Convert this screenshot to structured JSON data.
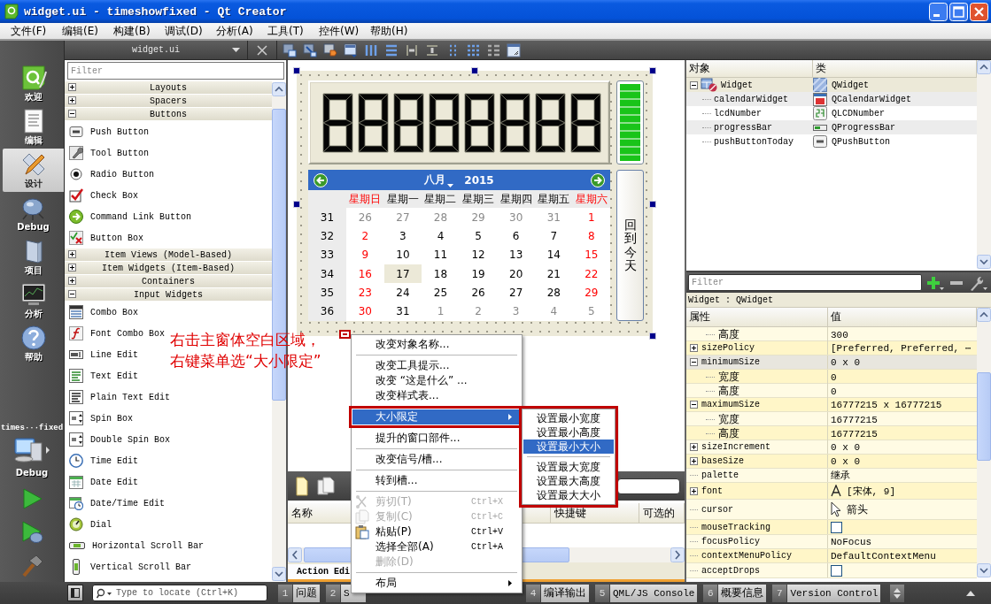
{
  "window": {
    "title": "widget.ui - timeshowfixed - Qt Creator"
  },
  "menu_bar": [
    "文件(F)",
    "编辑(E)",
    "构建(B)",
    "调试(D)",
    "分析(A)",
    "工具(T)",
    "控件(W)",
    "帮助(H)"
  ],
  "mode_bar": {
    "modes": [
      {
        "label": "欢迎",
        "selected": false
      },
      {
        "label": "编辑",
        "selected": false
      },
      {
        "label": "设计",
        "selected": true
      },
      {
        "label": "Debug",
        "selected": false
      },
      {
        "label": "项目",
        "selected": false
      },
      {
        "label": "分析",
        "selected": false
      },
      {
        "label": "帮助",
        "selected": false
      }
    ],
    "project": "times···fixed",
    "build_config": "Debug"
  },
  "editor_toolbar": {
    "file": "widget.ui"
  },
  "widget_box": {
    "filter_placeholder": "Filter",
    "categories": [
      {
        "label": "Layouts",
        "expanded": false
      },
      {
        "label": "Spacers",
        "expanded": false
      },
      {
        "label": "Buttons",
        "expanded": true,
        "items": [
          "Push Button",
          "Tool Button",
          "Radio Button",
          "Check Box",
          "Command Link Button",
          "Button Box"
        ]
      },
      {
        "label": "Item Views (Model-Based)",
        "expanded": false
      },
      {
        "label": "Item Widgets (Item-Based)",
        "expanded": false
      },
      {
        "label": "Containers",
        "expanded": false
      },
      {
        "label": "Input Widgets",
        "expanded": true,
        "items": [
          "Combo Box",
          "Font Combo Box",
          "Line Edit",
          "Text Edit",
          "Plain Text Edit",
          "Spin Box",
          "Double Spin Box",
          "Time Edit",
          "Date Edit",
          "Date/Time Edit",
          "Dial",
          "Horizontal Scroll Bar",
          "Vertical Scroll Bar"
        ]
      }
    ]
  },
  "form": {
    "progress_bar": {
      "level": 1
    },
    "calendar": {
      "month": "八月",
      "year": "2015",
      "weekdays": [
        {
          "label": "星期日",
          "weekend": true
        },
        {
          "label": "星期一",
          "weekend": false
        },
        {
          "label": "星期二",
          "weekend": false
        },
        {
          "label": "星期三",
          "weekend": false
        },
        {
          "label": "星期四",
          "weekend": false
        },
        {
          "label": "星期五",
          "weekend": false
        },
        {
          "label": "星期六",
          "weekend": true
        }
      ],
      "weeks": [
        {
          "number": "31",
          "days": [
            {
              "label": "26",
              "other_month": true,
              "selected": false
            },
            {
              "label": "27",
              "other_month": true,
              "selected": false
            },
            {
              "label": "28",
              "other_month": true,
              "selected": false
            },
            {
              "label": "29",
              "other_month": true,
              "selected": false
            },
            {
              "label": "30",
              "other_month": true,
              "selected": false
            },
            {
              "label": "31",
              "other_month": true,
              "selected": false
            },
            {
              "label": "1",
              "other_month": false,
              "selected": false
            }
          ]
        },
        {
          "number": "32",
          "days": [
            {
              "label": "2",
              "other_month": false,
              "selected": false
            },
            {
              "label": "3",
              "other_month": false,
              "selected": false
            },
            {
              "label": "4",
              "other_month": false,
              "selected": false
            },
            {
              "label": "5",
              "other_month": false,
              "selected": false
            },
            {
              "label": "6",
              "other_month": false,
              "selected": false
            },
            {
              "label": "7",
              "other_month": false,
              "selected": false
            },
            {
              "label": "8",
              "other_month": false,
              "selected": false
            }
          ]
        },
        {
          "number": "33",
          "days": [
            {
              "label": "9",
              "other_month": false,
              "selected": false
            },
            {
              "label": "10",
              "other_month": false,
              "selected": false
            },
            {
              "label": "11",
              "other_month": false,
              "selected": false
            },
            {
              "label": "12",
              "other_month": false,
              "selected": false
            },
            {
              "label": "13",
              "other_month": false,
              "selected": false
            },
            {
              "label": "14",
              "other_month": false,
              "selected": false
            },
            {
              "label": "15",
              "other_month": false,
              "selected": false
            }
          ]
        },
        {
          "number": "34",
          "days": [
            {
              "label": "16",
              "other_month": false,
              "selected": false
            },
            {
              "label": "17",
              "other_month": false,
              "selected": true
            },
            {
              "label": "18",
              "other_month": false,
              "selected": false
            },
            {
              "label": "19",
              "other_month": false,
              "selected": false
            },
            {
              "label": "20",
              "other_month": false,
              "selected": false
            },
            {
              "label": "21",
              "other_month": false,
              "selected": false
            },
            {
              "label": "22",
              "other_month": false,
              "selected": false
            }
          ]
        },
        {
          "number": "35",
          "days": [
            {
              "label": "23",
              "other_month": false,
              "selected": false
            },
            {
              "label": "24",
              "other_month": false,
              "selected": false
            },
            {
              "label": "25",
              "other_month": false,
              "selected": false
            },
            {
              "label": "26",
              "other_month": false,
              "selected": false
            },
            {
              "label": "27",
              "other_month": false,
              "selected": false
            },
            {
              "label": "28",
              "other_month": false,
              "selected": false
            },
            {
              "label": "29",
              "other_month": false,
              "selected": false
            }
          ]
        },
        {
          "number": "36",
          "days": [
            {
              "label": "30",
              "other_month": false,
              "selected": false
            },
            {
              "label": "31",
              "other_month": false,
              "selected": false
            },
            {
              "label": "1",
              "other_month": true,
              "selected": false
            },
            {
              "label": "2",
              "other_month": true,
              "selected": false
            },
            {
              "label": "3",
              "other_month": true,
              "selected": false
            },
            {
              "label": "4",
              "other_month": true,
              "selected": false
            },
            {
              "label": "5",
              "other_month": true,
              "selected": false
            }
          ]
        }
      ]
    },
    "today_button": "回到今天"
  },
  "action_editor": {
    "columns": [
      "名称",
      "快捷键",
      "可选的"
    ],
    "tab": "Action Edi"
  },
  "object_inspector": {
    "columns": [
      "对象",
      "类"
    ],
    "tree": [
      {
        "name": "Widget",
        "class": "QWidget",
        "expanded": true,
        "selected": true,
        "children": [
          {
            "name": "calendarWidget",
            "class": "QCalendarWidget",
            "selected": false
          },
          {
            "name": "lcdNumber",
            "class": "QLCDNumber",
            "selected": false
          },
          {
            "name": "progressBar",
            "class": "QProgressBar",
            "selected": false
          },
          {
            "name": "pushButtonToday",
            "class": "QPushButton",
            "selected": false
          }
        ]
      }
    ]
  },
  "property_editor": {
    "filter_placeholder": "Filter",
    "object": "Widget : QWidget",
    "columns": [
      "属性",
      "值"
    ],
    "rows": [
      {
        "children": [
          {
            "name": "高度",
            "value": "300",
            "kind": "text",
            "selected": false
          }
        ]
      },
      {
        "name": "sizePolicy",
        "value": "[Preferred, Preferred, ⋯",
        "kind": "text",
        "expanded": false,
        "selected": false
      },
      {
        "name": "minimumSize",
        "value": "0 x 0",
        "kind": "text",
        "expanded": true,
        "selected": true,
        "children": [
          {
            "name": "宽度",
            "value": "0",
            "kind": "text",
            "selected": false
          },
          {
            "name": "高度",
            "value": "0",
            "kind": "text",
            "selected": false
          }
        ]
      },
      {
        "name": "maximumSize",
        "value": "16777215 x 16777215",
        "kind": "text",
        "expanded": true,
        "selected": false,
        "children": [
          {
            "name": "宽度",
            "value": "16777215",
            "kind": "text",
            "selected": false
          },
          {
            "name": "高度",
            "value": "16777215",
            "kind": "text",
            "selected": false
          }
        ]
      },
      {
        "name": "sizeIncrement",
        "value": "0 x 0",
        "kind": "text",
        "expanded": false,
        "selected": false
      },
      {
        "name": "baseSize",
        "value": "0 x 0",
        "kind": "text",
        "expanded": false,
        "selected": false
      },
      {
        "name": "palette",
        "value": "继承",
        "kind": "text",
        "selected": false
      },
      {
        "name": "font",
        "value": "[宋体, 9]",
        "kind": "font",
        "expanded": false,
        "selected": false
      },
      {
        "name": "cursor",
        "value": "箭头",
        "kind": "cursor",
        "selected": false
      },
      {
        "name": "mouseTracking",
        "kind": "check",
        "checked": false,
        "selected": false
      },
      {
        "name": "focusPolicy",
        "value": "NoFocus",
        "kind": "text",
        "selected": false
      },
      {
        "name": "contextMenuPolicy",
        "value": "DefaultContextMenu",
        "kind": "text",
        "selected": false
      },
      {
        "name": "acceptDrops",
        "kind": "check",
        "checked": false,
        "selected": false
      }
    ]
  },
  "status_bar": {
    "locator_placeholder": "Type to locate (Ctrl+K)",
    "panes": [
      {
        "number": "1",
        "label": "问题"
      },
      {
        "number": "2",
        "label": "S"
      },
      {
        "number": "4",
        "label": "编译输出"
      },
      {
        "number": "5",
        "label": "QML/JS Console"
      },
      {
        "number": "6",
        "label": "概要信息"
      },
      {
        "number": "7",
        "label": "Version Control"
      }
    ]
  },
  "annotation": {
    "lines": [
      "右击主窗体空白区域，",
      "右键菜单选“大小限定”"
    ]
  },
  "context_menu": {
    "items": [
      {
        "kind": "action",
        "label": "改变对象名称...",
        "disabled": false,
        "selected": false
      },
      {
        "kind": "separator"
      },
      {
        "kind": "action",
        "label": "改变工具提示...",
        "disabled": false,
        "selected": false
      },
      {
        "kind": "action",
        "label": "改变 “这是什么” ...",
        "disabled": false,
        "selected": false
      },
      {
        "kind": "action",
        "label": "改变样式表...",
        "disabled": false,
        "selected": false
      },
      {
        "kind": "separator"
      },
      {
        "kind": "submenu",
        "label": "大小限定",
        "disabled": false,
        "selected": true
      },
      {
        "kind": "separator"
      },
      {
        "kind": "action",
        "label": "提升的窗口部件...",
        "disabled": false,
        "selected": false
      },
      {
        "kind": "separator"
      },
      {
        "kind": "action",
        "label": "改变信号/槽...",
        "disabled": false,
        "selected": false
      },
      {
        "kind": "separator"
      },
      {
        "kind": "action",
        "label": "转到槽...",
        "disabled": false,
        "selected": false
      },
      {
        "kind": "separator"
      },
      {
        "kind": "action",
        "label": "剪切(T)",
        "shortcut": "Ctrl+X",
        "disabled": true,
        "selected": false
      },
      {
        "kind": "action",
        "label": "复制(C)",
        "shortcut": "Ctrl+C",
        "disabled": true,
        "selected": false
      },
      {
        "kind": "action",
        "label": "粘贴(P)",
        "shortcut": "Ctrl+V",
        "disabled": false,
        "selected": false
      },
      {
        "kind": "action",
        "label": "选择全部(A)",
        "shortcut": "Ctrl+A",
        "disabled": false,
        "selected": false
      },
      {
        "kind": "action",
        "label": "删除(D)",
        "disabled": true,
        "selected": false
      },
      {
        "kind": "separator"
      },
      {
        "kind": "submenu",
        "label": "布局",
        "disabled": false,
        "selected": false
      }
    ],
    "submenu": [
      {
        "kind": "action",
        "label": "设置最小宽度",
        "selected": false
      },
      {
        "kind": "action",
        "label": "设置最小高度",
        "selected": false
      },
      {
        "kind": "action",
        "label": "设置最小大小",
        "selected": true
      },
      {
        "kind": "separator"
      },
      {
        "kind": "action",
        "label": "设置最大宽度",
        "selected": false
      },
      {
        "kind": "action",
        "label": "设置最大高度",
        "selected": false
      },
      {
        "kind": "action",
        "label": "设置最大大小",
        "selected": false
      }
    ]
  }
}
